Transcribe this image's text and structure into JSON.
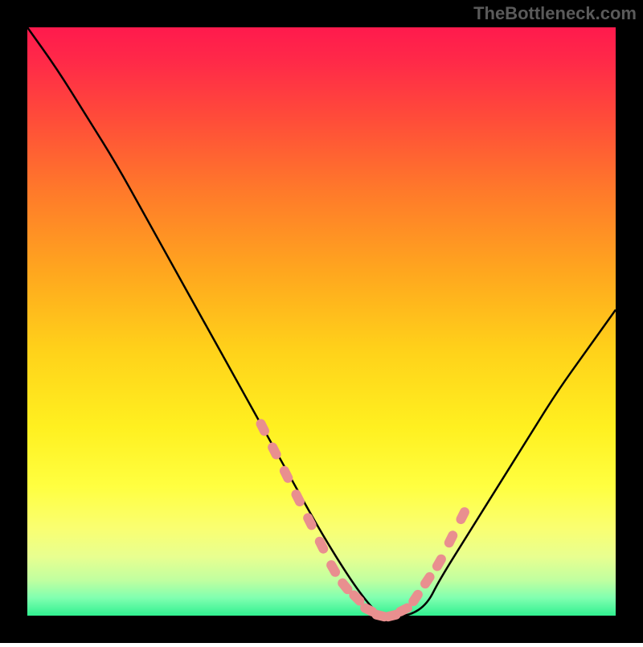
{
  "watermark": "TheBottleneck.com",
  "chart_data": {
    "type": "line",
    "title": "",
    "xlabel": "",
    "ylabel": "",
    "xlim": [
      0,
      100
    ],
    "ylim": [
      0,
      100
    ],
    "background_gradient": {
      "stops": [
        {
          "offset": 0.0,
          "color": "#ff1a4d"
        },
        {
          "offset": 0.06,
          "color": "#ff2a48"
        },
        {
          "offset": 0.15,
          "color": "#ff4a3a"
        },
        {
          "offset": 0.28,
          "color": "#ff7a2a"
        },
        {
          "offset": 0.42,
          "color": "#ffa81e"
        },
        {
          "offset": 0.55,
          "color": "#ffd21a"
        },
        {
          "offset": 0.68,
          "color": "#fff020"
        },
        {
          "offset": 0.78,
          "color": "#ffff40"
        },
        {
          "offset": 0.85,
          "color": "#faff70"
        },
        {
          "offset": 0.9,
          "color": "#e8ff90"
        },
        {
          "offset": 0.94,
          "color": "#c0ffa0"
        },
        {
          "offset": 0.97,
          "color": "#80ffb0"
        },
        {
          "offset": 1.0,
          "color": "#30f090"
        }
      ]
    },
    "series": [
      {
        "name": "bottleneck-curve",
        "type": "line",
        "color": "#000000",
        "x": [
          0,
          5,
          10,
          15,
          20,
          25,
          30,
          35,
          40,
          45,
          50,
          55,
          58,
          60,
          62,
          65,
          68,
          70,
          75,
          80,
          85,
          90,
          95,
          100
        ],
        "y": [
          100,
          93,
          85,
          77,
          68,
          59,
          50,
          41,
          32,
          23,
          14,
          6,
          2,
          0,
          0,
          0,
          2,
          6,
          14,
          22,
          30,
          38,
          45,
          52
        ]
      },
      {
        "name": "highlight-markers-left",
        "type": "scatter",
        "color": "#e98f8f",
        "x": [
          40,
          42,
          44,
          46,
          48,
          50,
          52,
          54,
          56
        ],
        "y": [
          32,
          28,
          24,
          20,
          16,
          12,
          8,
          5,
          3
        ]
      },
      {
        "name": "highlight-markers-bottom",
        "type": "scatter",
        "color": "#e98f8f",
        "x": [
          58,
          60,
          62,
          64
        ],
        "y": [
          1,
          0,
          0,
          1
        ]
      },
      {
        "name": "highlight-markers-right",
        "type": "scatter",
        "color": "#e98f8f",
        "x": [
          66,
          68,
          70,
          72,
          74
        ],
        "y": [
          3,
          6,
          9,
          13,
          17
        ]
      }
    ]
  }
}
